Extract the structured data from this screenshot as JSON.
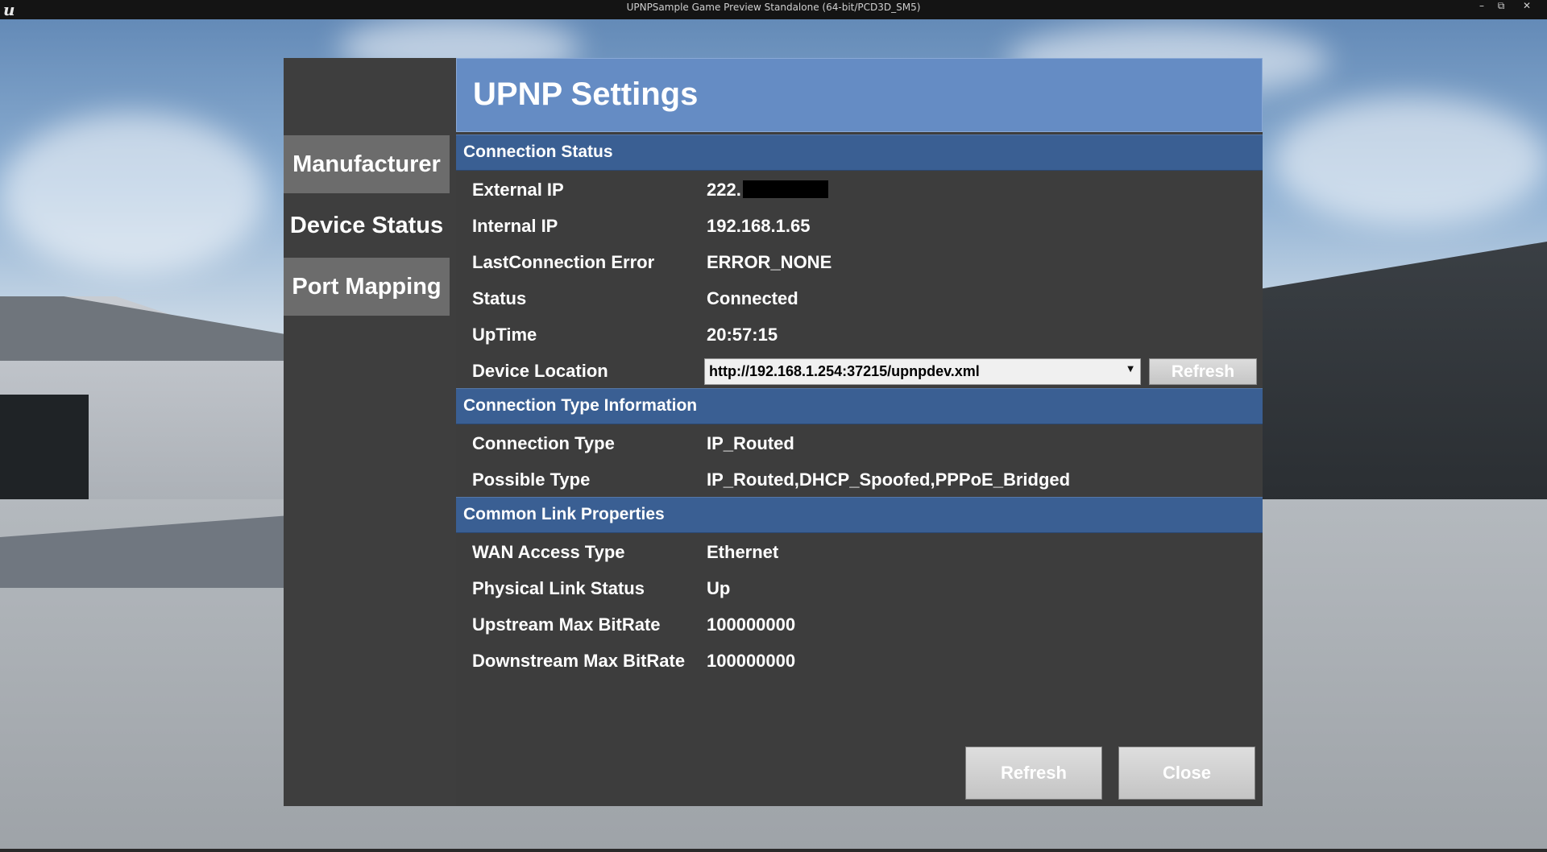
{
  "window": {
    "title": "UPNPSample Game Preview Standalone (64-bit/PCD3D_SM5)",
    "logo": "u",
    "minimize": "–",
    "maximize": "⧉",
    "close": "✕"
  },
  "sidebar": {
    "tabs": [
      {
        "label": "Manufacturer",
        "state": "inactive"
      },
      {
        "label": "Device Status",
        "state": "active"
      },
      {
        "label": "Port Mapping",
        "state": "inactive"
      }
    ]
  },
  "header": {
    "title": "UPNP Settings",
    "color": "#658cc4"
  },
  "sections": {
    "connection_status": {
      "title": "Connection Status",
      "rows": [
        {
          "label": "External IP",
          "value": "222."
        },
        {
          "label": "Internal IP",
          "value": "192.168.1.65"
        },
        {
          "label": "LastConnection Error",
          "value": "ERROR_NONE"
        },
        {
          "label": "Status",
          "value": "Connected"
        },
        {
          "label": "UpTime",
          "value": "20:57:15"
        },
        {
          "label": "Device Location"
        }
      ],
      "device_location": {
        "selected": "http://192.168.1.254:37215/upnpdev.xml",
        "refresh_label": "Refresh"
      }
    },
    "connection_type": {
      "title": "Connection Type Information",
      "rows": [
        {
          "label": "Connection Type",
          "value": "IP_Routed"
        },
        {
          "label": "Possible Type",
          "value": "IP_Routed,DHCP_Spoofed,PPPoE_Bridged"
        }
      ]
    },
    "common_link": {
      "title": "Common Link Properties",
      "rows": [
        {
          "label": "WAN Access Type",
          "value": "Ethernet"
        },
        {
          "label": "Physical Link Status",
          "value": "Up"
        },
        {
          "label": "Upstream Max BitRate",
          "value": "100000000"
        },
        {
          "label": "Downstream Max BitRate",
          "value": "100000000"
        }
      ]
    }
  },
  "footer": {
    "refresh_label": "Refresh",
    "close_label": "Close"
  },
  "colors": {
    "section_bar": "#3a5f93",
    "panel": "#3e3e3e",
    "tab_inactive": "#6c6c6c"
  }
}
